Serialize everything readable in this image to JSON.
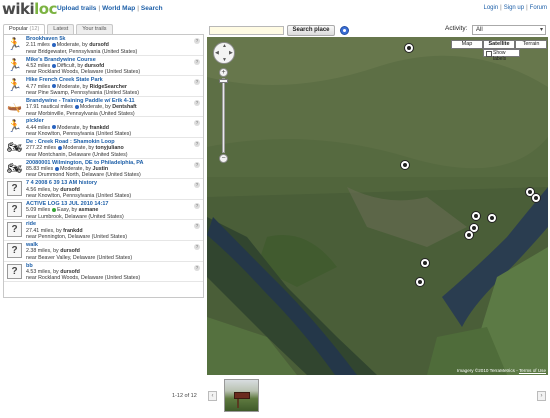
{
  "header": {
    "logo_part1": "wiki",
    "logo_part2": "loc",
    "nav": [
      "Upload trails",
      "World Map",
      "Search"
    ],
    "nav_sep": "|",
    "user_nav": [
      "Login",
      "Sign up",
      "Forum"
    ]
  },
  "tabs": [
    {
      "label": "Popular",
      "count": "(12)",
      "active": true
    },
    {
      "label": "Latest",
      "active": false
    },
    {
      "label": "Your trails",
      "active": false
    }
  ],
  "trails": [
    {
      "icon": "running-icon",
      "title": "Brookhaven 5k",
      "distance": "2.11 miles",
      "difficulty": "Moderate",
      "dot": "blue",
      "by": "by",
      "author": "dursofd",
      "near": "near  Bridgewater, Pennsylvania (United States)"
    },
    {
      "icon": "running-icon",
      "title": "Mike's Brandywine Course",
      "distance": "4.52 miles",
      "difficulty": "Difficult",
      "dot": "blue",
      "by": "by",
      "author": "dursofd",
      "near": "near  Rockland Woods, Delaware (United States)"
    },
    {
      "icon": "running-icon",
      "title": "Hike French Creek State Park",
      "distance": "4.77 miles",
      "difficulty": "Moderate",
      "dot": "blue",
      "by": "by",
      "author": "RidgeSearcher",
      "near": "near  Pine Swamp, Pennsylvania (United States)"
    },
    {
      "icon": "kayak-icon",
      "title": "Brandywine - Training Paddle w/ Erik 4-11",
      "distance": "17.91 nautical miles",
      "difficulty": "Moderate",
      "dot": "blue",
      "by": "by",
      "author": "Dentshaft",
      "near": "near  Morbinville, Pennsylvania (United States)"
    },
    {
      "icon": "running-icon",
      "title": "pickler",
      "distance": "4.44 miles",
      "difficulty": "Moderate",
      "dot": "blue",
      "by": "by",
      "author": "frankdd",
      "near": "near  Knowlton, Pennsylvania (United States)"
    },
    {
      "icon": "motorbike-icon",
      "title": "De : Creek Road : Shamokin Loop",
      "distance": "277.22 miles",
      "difficulty": "Moderate",
      "dot": "blue",
      "by": "by",
      "author": "tonyjuliano",
      "near": "near  Montchanin, Delaware (United States)"
    },
    {
      "icon": "motorbike-icon",
      "title": "20080001 Wilmington, DE to Philadelphia, PA",
      "distance": "85.83 miles",
      "difficulty": "Moderate",
      "dot": "blue",
      "by": "by",
      "author": "Justin",
      "near": "near  Drummond North, Delaware (United States)"
    },
    {
      "icon": "question-icon",
      "title": "7 4 2008 6 39 13 AM history",
      "distance": "4.56 miles",
      "difficulty": "",
      "dot": "",
      "by": "by",
      "author": "dursofd",
      "near": "near  Knowlton, Pennsylvania (United States)"
    },
    {
      "icon": "question-icon",
      "title": "ACTIVE LOG 13 JUL 2010 14:17",
      "distance": "5.09 miles",
      "difficulty": "Easy",
      "dot": "green",
      "by": "by",
      "author": "asmane",
      "near": "near  Lumbrook, Delaware (United States)"
    },
    {
      "icon": "question-icon",
      "title": "ride",
      "distance": "27.41 miles",
      "difficulty": "",
      "dot": "",
      "by": "by",
      "author": "frankdd",
      "near": "near  Pennington, Delaware (United States)"
    },
    {
      "icon": "question-icon",
      "title": "walk",
      "distance": "2.38 miles",
      "difficulty": "",
      "dot": "",
      "by": "by",
      "author": "dursofd",
      "near": "near  Beaver Valley, Delaware (United States)"
    },
    {
      "icon": "question-icon",
      "title": "bb",
      "distance": "4.53 miles",
      "difficulty": "",
      "dot": "",
      "by": "by",
      "author": "dursofd",
      "near": "near  Rockland Woods, Delaware (United States)"
    }
  ],
  "search": {
    "placeholder": "",
    "button": "Search place"
  },
  "activity": {
    "label": "Activity:",
    "selected": "All"
  },
  "map": {
    "types": [
      "Map",
      "Satellite",
      "Terrain"
    ],
    "active_type": "Satellite",
    "show_labels": "Show labels",
    "copyright": "Imagery ©2010 TerraMetrics -",
    "terms": "Terms of Use"
  },
  "pagination": {
    "text": "1-12 of 12"
  },
  "colors": {
    "link": "#1d5fa8",
    "logo_gray": "#4a4a4a",
    "logo_green": "#7cb342"
  }
}
